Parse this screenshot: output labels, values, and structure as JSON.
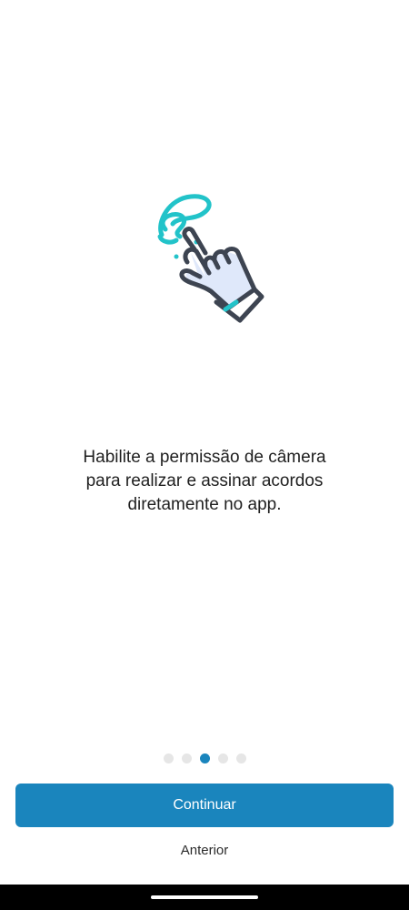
{
  "onboarding": {
    "illustration_icon": "hand-pointer-squiggle-icon",
    "message": "Habilite a permissão de câmera\npara realizar e assinar acordos\ndiretamente no app.",
    "pagination": {
      "total": 5,
      "current": 3
    },
    "continue_label": "Continuar",
    "previous_label": "Anterior"
  },
  "colors": {
    "accent": "#1a85bd",
    "illustration_accent": "#22c3c9",
    "illustration_stroke": "#3d4451",
    "illustration_fill": "#dfe8fa"
  }
}
